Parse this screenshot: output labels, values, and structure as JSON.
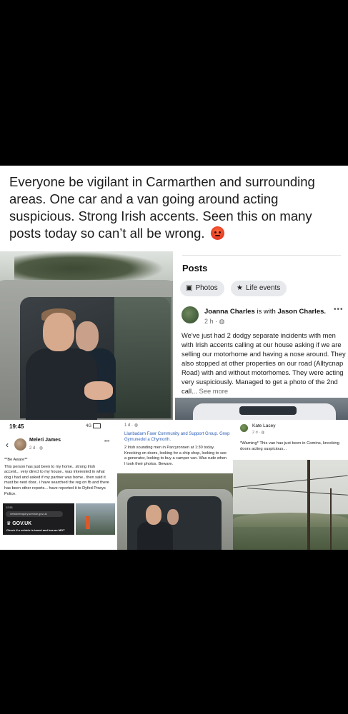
{
  "post": {
    "text": "Everyone be vigilant in Carmarthen and surrounding areas. One car and a van going around acting suspicious. Strong Irish accents. Seen this on many posts today so can’t all be wrong."
  },
  "fb_card": {
    "title": "Posts",
    "chips": [
      {
        "icon": "photos-icon",
        "glyph": "▣",
        "label": "Photos"
      },
      {
        "icon": "star-icon",
        "glyph": "★",
        "label": "Life events"
      }
    ],
    "author": "Joanna Charles",
    "with_text": " is with ",
    "tagged": "Jason Charles.",
    "time": "2 h · ",
    "body": "We've just had 2 dodgy separate incidents with men with Irish accents calling at our house asking if we are selling our motorhome and having a nose around. They also stopped at other properties on our road (Alltycnap Road) with and without motorhomes. They were acting very suspiciously. Managed to get a photo of the 2nd call...",
    "see_more": " See more"
  },
  "screenshot1": {
    "clock": "19:45",
    "status_right": "4G",
    "name": "Meleri James",
    "time": "2 d · ",
    "line1": "**Be Aware**",
    "body": "This person has just been to my home.. strong Irish accent... very direct to my house.. was interested in what dog i had and asked if my partner was home.. then said it must be next door.. i have searched the reg on fb and there has been other reports... have reported it to Dyfed Powys Police.",
    "inner_clock": "12:51",
    "url": "vehicleenquiry.service.gov.uk",
    "gov": "GOV.UK",
    "check": "Check if a vehicle is taxed and has an MOT"
  },
  "screenshot2": {
    "time": "1 d · ",
    "group": "Llanbadarn Fawr Community and Support Group. Grwp Gymunedol a Chymorth.",
    "body": "2 Irish sounding men in Parcyronnen at 1:30 today. Knocking on doors, looking for a chip shop, looking to see a generator, looking to buy a camper van. Was rude when I took their photos. Beware."
  },
  "screenshot3": {
    "name": "Kate Lacey",
    "time": "2 d · ",
    "body": "*Warning* This van has just been in Comins, knocking doors acting suspicious..."
  }
}
